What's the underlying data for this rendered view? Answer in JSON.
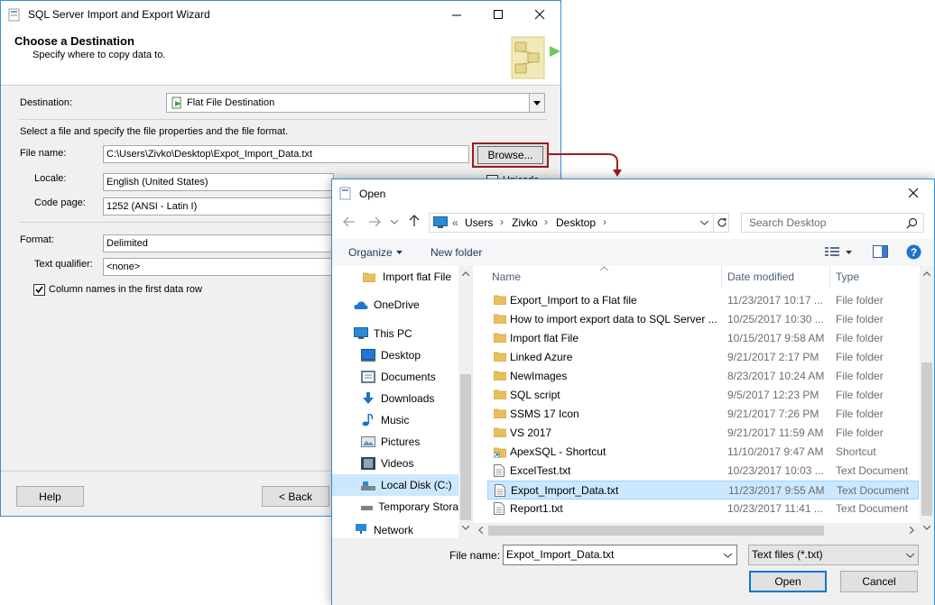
{
  "wizard": {
    "title": "SQL Server Import and Export Wizard",
    "header_title": "Choose a Destination",
    "header_subtitle": "Specify where to copy data to.",
    "destination_label": "Destination:",
    "destination_value": "Flat File Destination",
    "instructions": "Select a file and specify the file properties and the file format.",
    "file_name_label": "File name:",
    "file_name_value": "C:\\Users\\Zivko\\Desktop\\Expot_Import_Data.txt",
    "browse_label": "Browse...",
    "unicode_label": "Unicode",
    "locale_label": "Locale:",
    "locale_value": "English (United States)",
    "code_page_label": "Code page:",
    "code_page_value": "1252  (ANSI - Latin I)",
    "format_label": "Format:",
    "format_value": "Delimited",
    "text_qualifier_label": "Text qualifier:",
    "text_qualifier_value": "<none>",
    "column_names_label": "Column names in the first data row",
    "help_label": "Help",
    "back_label": "< Back"
  },
  "open_dialog": {
    "title": "Open",
    "breadcrumb": [
      "Users",
      "Zivko",
      "Desktop"
    ],
    "breadcrumb_prefix": "«",
    "search_placeholder": "Search Desktop",
    "organize_label": "Organize",
    "new_folder_label": "New folder",
    "nav": [
      {
        "label": "Import flat File",
        "icon": "folder-icon"
      },
      {
        "label": "OneDrive",
        "icon": "onedrive-icon"
      },
      {
        "label": "This PC",
        "icon": "this-pc-icon"
      },
      {
        "label": "Desktop",
        "icon": "desktop-icon"
      },
      {
        "label": "Documents",
        "icon": "documents-icon"
      },
      {
        "label": "Downloads",
        "icon": "downloads-icon"
      },
      {
        "label": "Music",
        "icon": "music-icon"
      },
      {
        "label": "Pictures",
        "icon": "pictures-icon"
      },
      {
        "label": "Videos",
        "icon": "videos-icon"
      },
      {
        "label": "Local Disk (C:)",
        "icon": "local-disk-icon"
      },
      {
        "label": "Temporary Stora",
        "icon": "drive-icon"
      },
      {
        "label": "Network",
        "icon": "network-icon"
      }
    ],
    "columns": {
      "name": "Name",
      "date": "Date modified",
      "type": "Type"
    },
    "files": [
      {
        "name": "Export_Import to a Flat file",
        "date": "11/23/2017 10:17 ...",
        "type": "File folder",
        "icon": "folder-icon"
      },
      {
        "name": "How to import export data to SQL Server ...",
        "date": "10/25/2017 10:30 ...",
        "type": "File folder",
        "icon": "folder-icon"
      },
      {
        "name": "Import flat File",
        "date": "10/15/2017 9:58 AM",
        "type": "File folder",
        "icon": "folder-icon"
      },
      {
        "name": "Linked Azure",
        "date": "9/21/2017 2:17 PM",
        "type": "File folder",
        "icon": "folder-icon"
      },
      {
        "name": "NewImages",
        "date": "8/23/2017 10:24 AM",
        "type": "File folder",
        "icon": "folder-icon"
      },
      {
        "name": "SQL script",
        "date": "9/5/2017 12:23 PM",
        "type": "File folder",
        "icon": "folder-icon"
      },
      {
        "name": "SSMS 17 Icon",
        "date": "9/21/2017 7:26 PM",
        "type": "File folder",
        "icon": "folder-icon"
      },
      {
        "name": "VS 2017",
        "date": "9/21/2017 11:59 AM",
        "type": "File folder",
        "icon": "folder-icon"
      },
      {
        "name": "ApexSQL - Shortcut",
        "date": "11/10/2017 9:47 AM",
        "type": "Shortcut",
        "icon": "shortcut-icon"
      },
      {
        "name": "ExcelTest.txt",
        "date": "10/23/2017 10:03 ...",
        "type": "Text Document",
        "icon": "text-file-icon"
      },
      {
        "name": "Expot_Import_Data.txt",
        "date": "11/23/2017 9:55 AM",
        "type": "Text Document",
        "icon": "text-file-icon"
      },
      {
        "name": "Report1.txt",
        "date": "10/23/2017 11:41 ...",
        "type": "Text Document",
        "icon": "text-file-icon"
      }
    ],
    "selected_index": 10,
    "file_name_label": "File name:",
    "file_name_value": "Expot_Import_Data.txt",
    "filter_value": "Text files (*.txt)",
    "open_label": "Open",
    "cancel_label": "Cancel"
  },
  "colors": {
    "accent_border": "#3c8fd4",
    "selection": "#cce8ff",
    "highlight_box": "#9b1c1c",
    "folder": "#e8c05a"
  }
}
